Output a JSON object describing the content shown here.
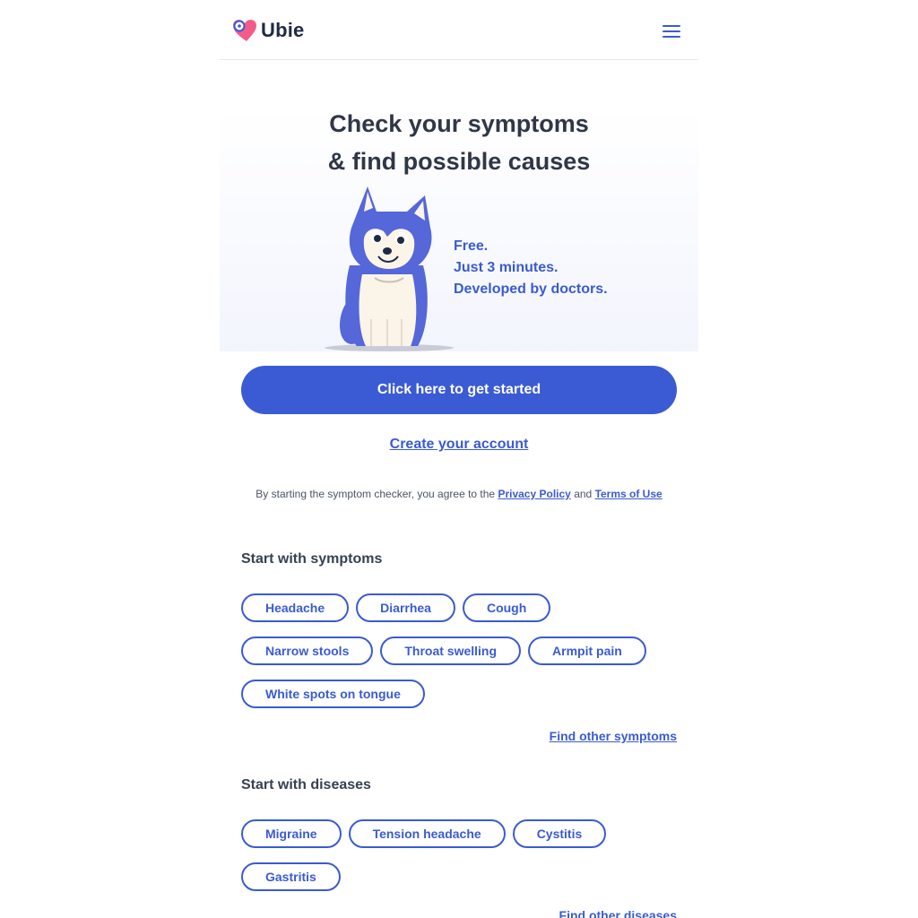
{
  "header": {
    "logo_text": "Ubie",
    "menu_icon": "hamburger-menu-icon"
  },
  "hero": {
    "title_line1": "Check your symptoms",
    "title_line2": "& find possible causes",
    "points": [
      "Free.",
      "Just 3 minutes.",
      "Developed by doctors."
    ]
  },
  "cta": {
    "start_label": "Click here to get started",
    "account_label": "Create your account"
  },
  "terms": {
    "prefix": "By starting the symptom checker, you agree to the",
    "privacy_label": "Privacy Policy",
    "and": "and",
    "terms_label": "Terms of Use"
  },
  "symptoms": {
    "title": "Start with symptoms",
    "items": [
      "Headache",
      "Diarrhea",
      "Cough",
      "Narrow stools",
      "Throat swelling",
      "Armpit pain",
      "White spots on tongue"
    ],
    "find_other": "Find other symptoms"
  },
  "diseases": {
    "title": "Start with diseases",
    "items": [
      "Migraine",
      "Tension headache",
      "Cystitis",
      "Gastritis"
    ],
    "find_other": "Find other diseases"
  },
  "colors": {
    "brand_blue": "#3b5bd4",
    "logo_pink": "#f35b8a",
    "text_dark": "#2f3747"
  }
}
